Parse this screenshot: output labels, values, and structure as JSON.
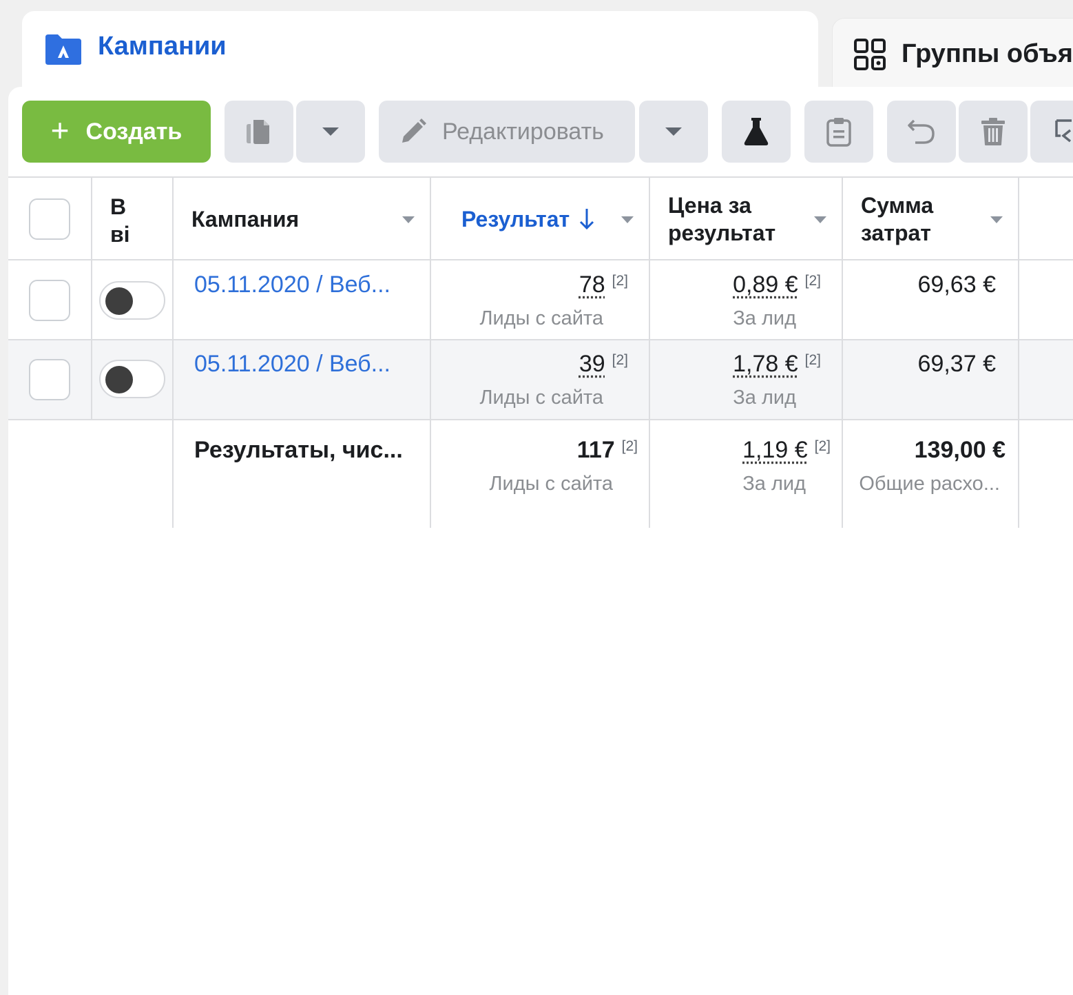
{
  "tabs": {
    "active_label": "Кампании",
    "inactive_label": "Группы объя"
  },
  "toolbar": {
    "create_label": "Создать",
    "edit_label": "Редактировать"
  },
  "table": {
    "headers": {
      "col1": "В",
      "col1b": "ві",
      "campaign": "Кампания",
      "result": "Результат",
      "cost_l1": "Цена за",
      "cost_l2": "результат",
      "spend_l1": "Сумма",
      "spend_l2": "затрат"
    },
    "rows": [
      {
        "name": "05.11.2020 / Веб...",
        "result": "78",
        "result_note": "[2]",
        "result_sub": "Лиды с сайта",
        "cost": "0,89 €",
        "cost_note": "[2]",
        "cost_sub": "За лид",
        "spend": "69,63 €"
      },
      {
        "name": "05.11.2020 / Веб...",
        "result": "39",
        "result_note": "[2]",
        "result_sub": "Лиды с сайта",
        "cost": "1,78 €",
        "cost_note": "[2]",
        "cost_sub": "За лид",
        "spend": "69,37 €"
      }
    ],
    "totals": {
      "label": "Результаты, чис...",
      "result": "117",
      "result_note": "[2]",
      "result_sub": "Лиды с сайта",
      "cost": "1,19 €",
      "cost_note": "[2]",
      "cost_sub": "За лид",
      "spend": "139,00 €",
      "spend_sub": "Общие расхо..."
    }
  }
}
